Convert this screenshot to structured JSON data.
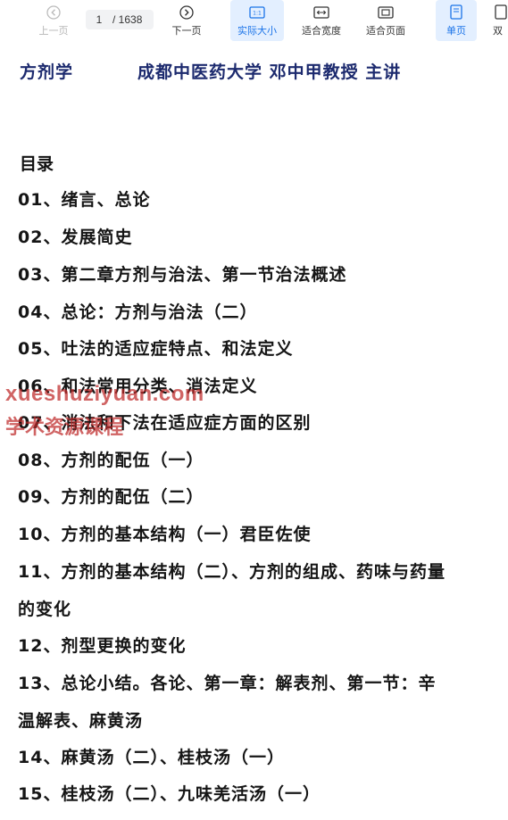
{
  "toolbar": {
    "prev_label": "上一页",
    "page_current": "1",
    "page_total": "/ 1638",
    "next_label": "下一页",
    "actual_size_label": "实际大小",
    "fit_width_label": "适合宽度",
    "fit_page_label": "适合页面",
    "single_page_label": "单页",
    "double_page_label": "双"
  },
  "document": {
    "header_course": "方剂学",
    "header_lecturer": "成都中医药大学 邓中甲教授 主讲",
    "toc_title": "目录",
    "toc_lines": [
      "01、绪言、总论",
      "02、发展简史",
      "03、第二章方剂与治法、第一节治法概述",
      "04、总论：方剂与治法（二）",
      "05、吐法的适应症特点、和法定义",
      "06、和法常用分类、消法定义",
      "07、消法和下法在适应症方面的区别",
      "08、方剂的配伍（一）",
      "09、方剂的配伍（二）",
      "10、方剂的基本结构（一）君臣佐使",
      "11、方剂的基本结构（二）、方剂的组成、药味与药量",
      "的变化",
      "12、剂型更换的变化",
      "13、总论小结。各论、第一章：解表剂、第一节：辛",
      "温解表、麻黄汤",
      "14、麻黄汤（二）、桂枝汤（一）",
      "15、桂枝汤（二）、九味羌活汤（一）"
    ]
  },
  "watermark": {
    "line1": "xueshuziyuan.com",
    "line2": "学术资源课程"
  }
}
